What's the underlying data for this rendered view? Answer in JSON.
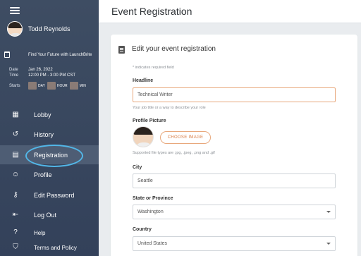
{
  "sidebar": {
    "user_name": "Todd Reynolds",
    "event": {
      "title": "Find Your Future with LaunchBrite",
      "date_label": "Date",
      "date_value": "Jan 26, 2022",
      "time_label": "Time",
      "time_value": "12:00 PM - 3:00 PM CST",
      "starts_label": "Starts",
      "countdown_units": [
        "DAY",
        "HOUR",
        "MIN"
      ]
    },
    "nav": [
      {
        "label": "Lobby",
        "icon": "lobby-icon"
      },
      {
        "label": "History",
        "icon": "history-icon"
      },
      {
        "label": "Registration",
        "icon": "clipboard-icon",
        "active": true
      },
      {
        "label": "Profile",
        "icon": "profile-icon"
      },
      {
        "label": "Edit Password",
        "icon": "key-icon"
      },
      {
        "label": "Log Out",
        "icon": "logout-icon"
      },
      {
        "label": "Help",
        "icon": "help-icon"
      },
      {
        "label": "Terms and Policy",
        "icon": "shield-icon"
      }
    ]
  },
  "header": {
    "title": "Event Registration"
  },
  "form": {
    "title": "Edit your event registration",
    "required_note": "* indicates required field",
    "headline_label": "Headline",
    "headline_value": "Technical Writer",
    "headline_helper": "Your job title or a way to describe your role",
    "picture_label": "Profile Picture",
    "choose_image": "CHOOSE IMAGE",
    "picture_helper": "Supported file types are .jpg, .jpeg, .png and .gif",
    "city_label": "City",
    "city_value": "Seattle",
    "state_label": "State or Province",
    "state_value": "Washington",
    "country_label": "Country",
    "country_value": "United States"
  },
  "colors": {
    "sidebar": "#3e4d63",
    "accent": "#e8a87c",
    "highlight": "#52b7e8"
  }
}
